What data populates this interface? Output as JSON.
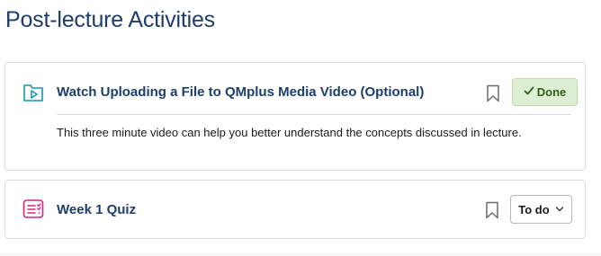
{
  "section": {
    "title": "Post-lecture Activities"
  },
  "activities": [
    {
      "title": "Watch Uploading a File to QMplus Media Video (Optional)",
      "description": "This three minute video can help you better understand the concepts discussed in lecture.",
      "icon": "video-play-icon",
      "icon_color": "#0f9aa8",
      "completion_label": "Done",
      "completion_color": "#325d16"
    },
    {
      "title": "Week 1 Quiz",
      "icon": "quiz-icon",
      "icon_color": "#d6247a",
      "completion_label": "To do"
    }
  ],
  "colors": {
    "title": "#1d3d6d",
    "done_bg": "#dcefd4",
    "border": "#dcdcdc"
  }
}
